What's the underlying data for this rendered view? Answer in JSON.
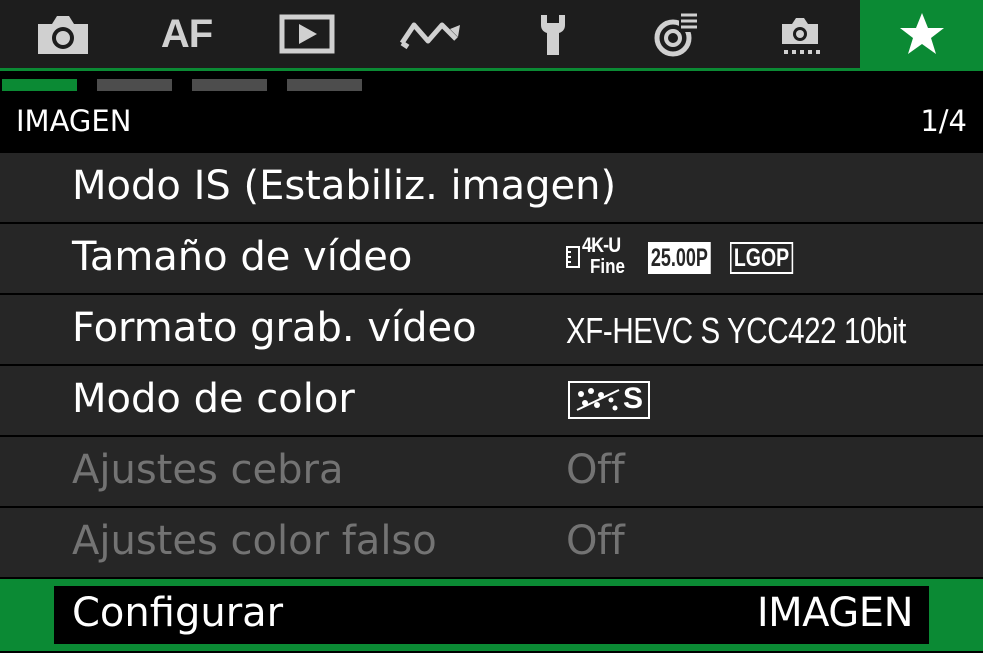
{
  "tabs": [
    {
      "name": "camera-icon"
    },
    {
      "name": "af-tab",
      "label": "AF"
    },
    {
      "name": "playback-icon"
    },
    {
      "name": "custom-wave-icon"
    },
    {
      "name": "wrench-icon"
    },
    {
      "name": "network-icon"
    },
    {
      "name": "camera-settings-icon"
    },
    {
      "name": "star-icon",
      "active": true
    }
  ],
  "pages": {
    "count": 4,
    "current": 1
  },
  "header": {
    "title": "IMAGEN",
    "page": "1/4"
  },
  "menu": {
    "items": [
      {
        "label": "Modo IS (Estabiliz. imagen)",
        "value": ""
      },
      {
        "label": "Tamaño de vídeo",
        "value": "",
        "badges": {
          "size": "4K-U",
          "quality": "Fine",
          "fps": "25.00P",
          "compression": "LGOP"
        }
      },
      {
        "label": "Formato grab. vídeo",
        "value": "XF-HEVC S YCC422 10bit"
      },
      {
        "label": "Modo de color",
        "value": "",
        "badge_letter": "S",
        "icon": "color-mode-icon"
      },
      {
        "label": "Ajustes cebra",
        "value": "Off",
        "disabled": true
      },
      {
        "label": "Ajustes color falso",
        "value": "Off",
        "disabled": true
      },
      {
        "label": "Configurar",
        "value": "IMAGEN",
        "selected": true
      }
    ]
  },
  "colors": {
    "accent": "#0b8a34",
    "row_bg": "#262626",
    "disabled_text": "#737373",
    "tab_bg": "#1d1d1d"
  }
}
